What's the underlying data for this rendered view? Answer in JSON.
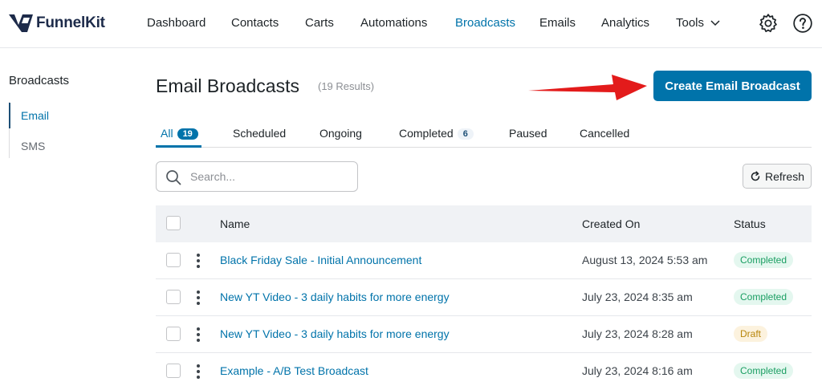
{
  "brand": {
    "name": "FunnelKit",
    "logo_color": "#1d2b4a",
    "accent": "#0073aa"
  },
  "nav": {
    "items": [
      "Dashboard",
      "Contacts",
      "Carts",
      "Automations",
      "Broadcasts",
      "Emails",
      "Analytics"
    ],
    "tools_label": "Tools",
    "active": "Broadcasts",
    "icons": [
      "gear-icon",
      "help-icon"
    ]
  },
  "sidebar": {
    "title": "Broadcasts",
    "items": [
      "Email",
      "SMS"
    ],
    "active": "Email"
  },
  "header": {
    "title": "Email Broadcasts",
    "results": "(19 Results)",
    "create_label": "Create Email Broadcast"
  },
  "tabs": {
    "all": {
      "label": "All",
      "count": "19"
    },
    "scheduled": {
      "label": "Scheduled"
    },
    "ongoing": {
      "label": "Ongoing"
    },
    "completed": {
      "label": "Completed",
      "count": "6"
    },
    "paused": {
      "label": "Paused"
    },
    "cancelled": {
      "label": "Cancelled"
    }
  },
  "search": {
    "placeholder": "Search..."
  },
  "refresh_label": "Refresh",
  "table": {
    "columns": {
      "name": "Name",
      "created": "Created On",
      "status": "Status"
    },
    "rows": [
      {
        "name": "Black Friday Sale - Initial Announcement",
        "created": "August 13, 2024 5:53 am",
        "status": "Completed"
      },
      {
        "name": "New YT Video - 3 daily habits for more energy",
        "created": "July 23, 2024 8:35 am",
        "status": "Completed"
      },
      {
        "name": "New YT Video - 3 daily habits for more energy",
        "created": "July 23, 2024 8:28 am",
        "status": "Draft"
      },
      {
        "name": "Example - A/B Test Broadcast",
        "created": "July 23, 2024 8:16 am",
        "status": "Completed"
      }
    ]
  },
  "colors": {
    "completed_bg": "#e4f7ef",
    "completed_text": "#1a9e62",
    "draft_bg": "#fcf2de",
    "draft_text": "#b8860b",
    "arrow": "#e31b1b"
  }
}
